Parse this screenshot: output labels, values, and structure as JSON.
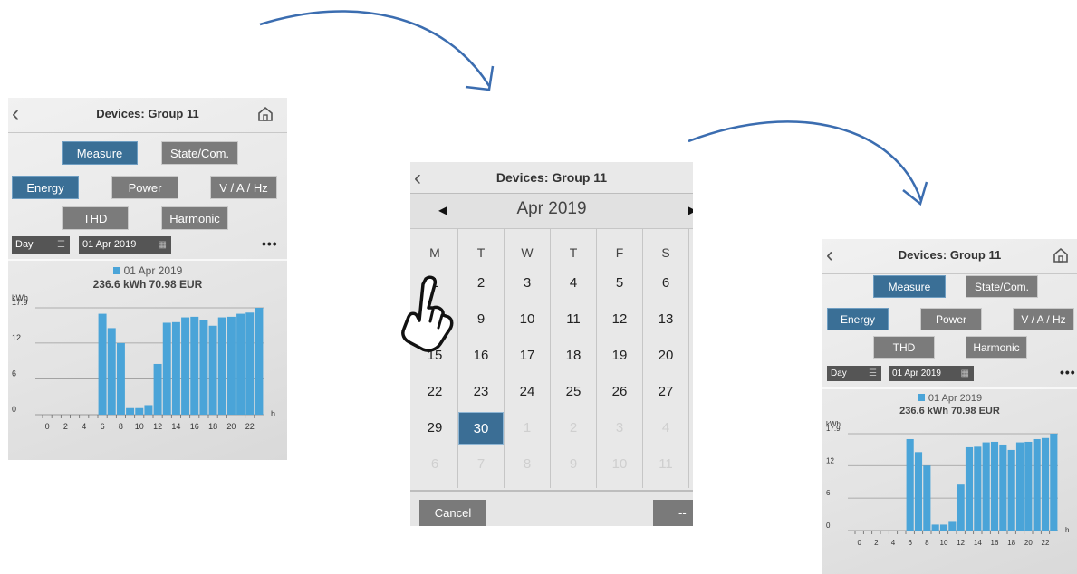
{
  "colors": {
    "accent": "#3a6f96",
    "bar": "#4aa4d8",
    "arrow": "#3b6db0",
    "button": "#7b7b7b"
  },
  "left_screen": {
    "title": "Devices: Group 11",
    "back_icon": "chevron-left-icon",
    "home_icon": "home-icon",
    "tabs": {
      "measure": "Measure",
      "state": "State/Com."
    },
    "modes": {
      "energy": "Energy",
      "power": "Power",
      "vah": "V / A / Hz",
      "thd": "THD",
      "harmonic": "Harmonic"
    },
    "period": "Day",
    "date": "01 Apr 2019",
    "more": "•••",
    "legend": "01 Apr 2019",
    "summary": "236.6 kWh 70.98 EUR"
  },
  "calendar": {
    "title": "Devices: Group 11",
    "month": "Apr 2019",
    "prev_icon": "◀",
    "next_icon": "▶",
    "weekdays": [
      "M",
      "T",
      "W",
      "T",
      "F",
      "S"
    ],
    "rows": [
      [
        "1",
        "2",
        "3",
        "4",
        "5",
        "6"
      ],
      [
        "8",
        "9",
        "10",
        "11",
        "12",
        "13"
      ],
      [
        "15",
        "16",
        "17",
        "18",
        "19",
        "20"
      ],
      [
        "22",
        "23",
        "24",
        "25",
        "26",
        "27"
      ],
      [
        "29",
        "30",
        "1",
        "2",
        "3",
        "4"
      ],
      [
        "6",
        "7",
        "8",
        "9",
        "10",
        "11"
      ]
    ],
    "faded_from": [
      [
        4,
        2
      ],
      [
        5,
        0
      ]
    ],
    "selected": "30",
    "cancel": "Cancel",
    "ok": "--"
  },
  "right_screen": {
    "title": "Devices: Group 11",
    "tabs": {
      "measure": "Measure",
      "state": "State/Com."
    },
    "modes": {
      "energy": "Energy",
      "power": "Power",
      "vah": "V / A / Hz",
      "thd": "THD",
      "harmonic": "Harmonic"
    },
    "period": "Day",
    "date": "01 Apr 2019",
    "more": "•••",
    "legend": "01 Apr 2019",
    "summary": "236.6 kWh 70.98 EUR"
  },
  "chart_data": {
    "type": "bar",
    "ylabel": "kWh",
    "xlabel": "h",
    "ylim": [
      0,
      17.9
    ],
    "yticks": [
      "0",
      "6",
      "12",
      "17.9"
    ],
    "xticks": [
      "0",
      "2",
      "4",
      "6",
      "8",
      "10",
      "12",
      "14",
      "16",
      "18",
      "20",
      "22"
    ],
    "legend": "01 Apr 2019",
    "categories": [
      0,
      1,
      2,
      3,
      4,
      5,
      6,
      7,
      8,
      9,
      10,
      11,
      12,
      13,
      14,
      15,
      16,
      17,
      18,
      19,
      20,
      21,
      22,
      23
    ],
    "values": [
      0,
      0,
      0,
      0,
      0,
      0,
      16.9,
      14.5,
      12.0,
      1.1,
      1.1,
      1.6,
      8.5,
      15.4,
      15.5,
      16.3,
      16.4,
      15.9,
      14.9,
      16.3,
      16.4,
      16.9,
      17.1,
      17.9
    ]
  }
}
